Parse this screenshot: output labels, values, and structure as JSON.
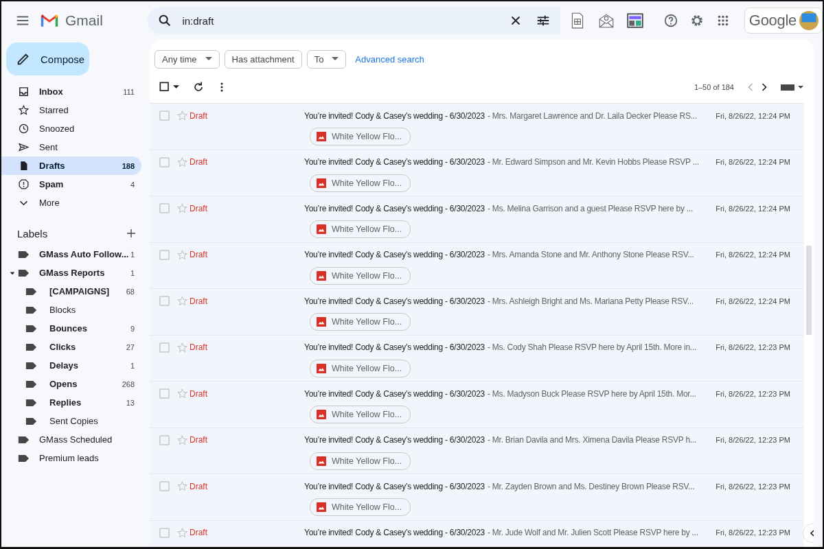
{
  "app": {
    "name": "Gmail"
  },
  "search": {
    "value": "in:draft"
  },
  "account": {
    "label": "Google"
  },
  "compose": {
    "label": "Compose"
  },
  "nav": [
    {
      "kind": "inbox",
      "label": "Inbox",
      "count": "111",
      "bold": true,
      "selected": false
    },
    {
      "kind": "star",
      "label": "Starred",
      "bold": false,
      "selected": false
    },
    {
      "kind": "clock",
      "label": "Snoozed",
      "bold": false,
      "selected": false
    },
    {
      "kind": "send",
      "label": "Sent",
      "bold": false,
      "selected": false
    },
    {
      "kind": "draft",
      "label": "Drafts",
      "count": "188",
      "bold": true,
      "selected": true
    },
    {
      "kind": "spam",
      "label": "Spam",
      "count": "4",
      "bold": true,
      "selected": false
    },
    {
      "kind": "more",
      "label": "More",
      "bold": false,
      "selected": false
    }
  ],
  "labels_heading": "Labels",
  "labels": [
    {
      "label": "GMass Auto Follow...",
      "count": "1",
      "bold": true
    },
    {
      "label": "GMass Reports",
      "count": "1",
      "bold": true,
      "expanded": true,
      "children": [
        {
          "label": "[CAMPAIGNS]",
          "count": "68",
          "bold": true
        },
        {
          "label": "Blocks",
          "bold": false
        },
        {
          "label": "Bounces",
          "count": "9",
          "bold": true
        },
        {
          "label": "Clicks",
          "count": "27",
          "bold": true
        },
        {
          "label": "Delays",
          "count": "1",
          "bold": true
        },
        {
          "label": "Opens",
          "count": "268",
          "bold": true
        },
        {
          "label": "Replies",
          "count": "13",
          "bold": true
        },
        {
          "label": "Sent Copies",
          "bold": false
        }
      ]
    },
    {
      "label": "GMass Scheduled",
      "bold": false
    },
    {
      "label": "Premium leads",
      "bold": false
    }
  ],
  "filters": [
    {
      "label": "Any time",
      "dropdown": true
    },
    {
      "label": "Has attachment",
      "dropdown": false
    },
    {
      "label": "To",
      "dropdown": true
    }
  ],
  "advanced_search": "Advanced search",
  "pagination": {
    "range": "1–50 of 184",
    "prev_disabled": true
  },
  "rows": [
    {
      "checked": false,
      "starred": false,
      "sender": "Draft",
      "subject": "You’re invited! Cody & Casey’s wedding - 6/30/2023",
      "snippet": "- Mrs. Margaret Lawrence and Dr. Laila Decker Please RS...",
      "date": "Fri, 8/26/22, 12:24 PM",
      "attachment": "White Yellow Flo..."
    },
    {
      "checked": false,
      "starred": false,
      "sender": "Draft",
      "subject": "You’re invited! Cody & Casey’s wedding - 6/30/2023",
      "snippet": "- Mr. Edward Simpson and Mr. Kevin Hobbs Please RSVP ...",
      "date": "Fri, 8/26/22, 12:24 PM",
      "attachment": "White Yellow Flo..."
    },
    {
      "checked": false,
      "starred": false,
      "sender": "Draft",
      "subject": "You’re invited! Cody & Casey’s wedding - 6/30/2023",
      "snippet": "- Ms. Melina Garrison and a guest Please RSVP here by ...",
      "date": "Fri, 8/26/22, 12:24 PM",
      "attachment": "White Yellow Flo..."
    },
    {
      "checked": false,
      "starred": false,
      "sender": "Draft",
      "subject": "You’re invited! Cody & Casey’s wedding - 6/30/2023",
      "snippet": "- Mrs. Amanda Stone and Mr. Anthony Stone Please RSV...",
      "date": "Fri, 8/26/22, 12:24 PM",
      "attachment": "White Yellow Flo..."
    },
    {
      "checked": false,
      "starred": false,
      "sender": "Draft",
      "subject": "You’re invited! Cody & Casey’s wedding - 6/30/2023",
      "snippet": "- Mrs. Ashleigh Bright and Ms. Mariana Petty Please RSV...",
      "date": "Fri, 8/26/22, 12:24 PM",
      "attachment": "White Yellow Flo..."
    },
    {
      "checked": false,
      "starred": false,
      "sender": "Draft",
      "subject": "You’re invited! Cody & Casey’s wedding - 6/30/2023",
      "snippet": "- Ms. Cody Shah Please RSVP here by April 15th. More in...",
      "date": "Fri, 8/26/22, 12:23 PM",
      "attachment": "White Yellow Flo..."
    },
    {
      "checked": false,
      "starred": false,
      "sender": "Draft",
      "subject": "You’re invited! Cody & Casey’s wedding - 6/30/2023",
      "snippet": "- Ms. Madyson Buck Please RSVP here by April 15th. Mor...",
      "date": "Fri, 8/26/22, 12:23 PM",
      "attachment": "White Yellow Flo..."
    },
    {
      "checked": false,
      "starred": false,
      "sender": "Draft",
      "subject": "You’re invited! Cody & Casey’s wedding - 6/30/2023",
      "snippet": "- Mr. Brian Davila and Mrs. Ximena Davila Please RSVP h...",
      "date": "Fri, 8/26/22, 12:23 PM",
      "attachment": "White Yellow Flo..."
    },
    {
      "checked": false,
      "starred": false,
      "sender": "Draft",
      "subject": "You’re invited! Cody & Casey’s wedding - 6/30/2023",
      "snippet": "- Mr. Zayden Brown and Ms. Destiney Brown Please RSV...",
      "date": "Fri, 8/26/22, 12:23 PM",
      "attachment": "White Yellow Flo..."
    },
    {
      "checked": false,
      "starred": false,
      "sender": "Draft",
      "subject": "You’re invited! Cody & Casey’s wedding - 6/30/2023",
      "snippet": "- Mr. Jude Wolf and Mr. Julien Scott Please RSVP here by ...",
      "date": "Fri, 8/26/22, 12:23 PM"
    }
  ]
}
